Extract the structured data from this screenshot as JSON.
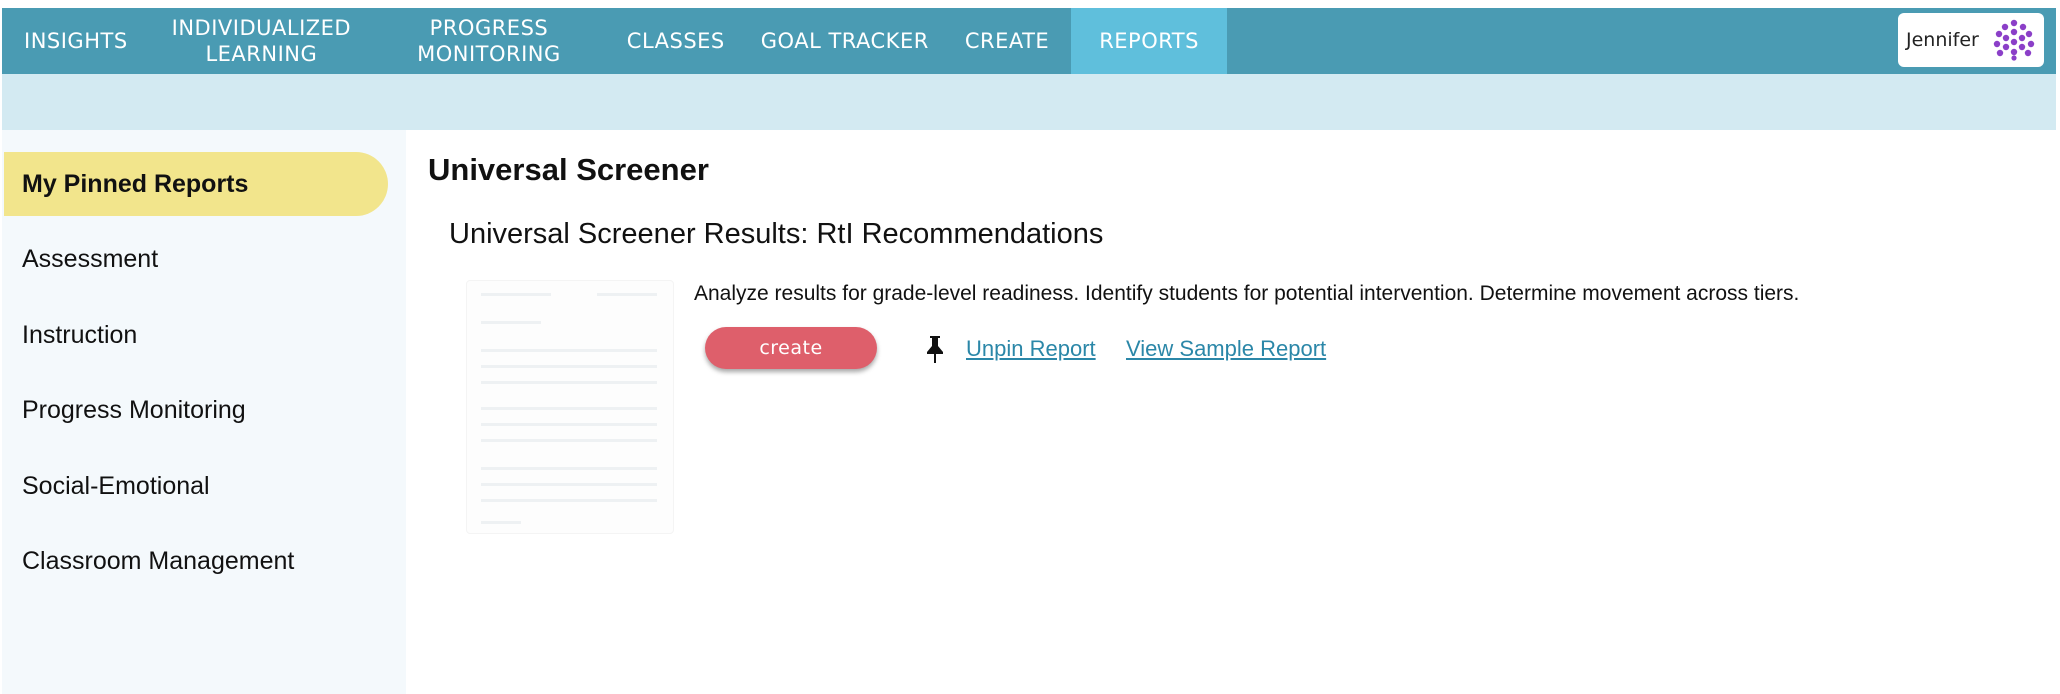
{
  "nav": {
    "items": [
      {
        "label": "INSIGHTS"
      },
      {
        "label": "INDIVIDUALIZED\nLEARNING"
      },
      {
        "label": "PROGRESS\nMONITORING"
      },
      {
        "label": "CLASSES"
      },
      {
        "label": "GOAL TRACKER"
      },
      {
        "label": "CREATE"
      },
      {
        "label": "REPORTS",
        "active": true
      }
    ],
    "user_name": "Jennifer"
  },
  "sidebar": {
    "items": [
      {
        "label": "My Pinned Reports",
        "active": true
      },
      {
        "label": "Assessment"
      },
      {
        "label": "Instruction"
      },
      {
        "label": "Progress Monitoring"
      },
      {
        "label": "Social-Emotional"
      },
      {
        "label": "Classroom Management"
      }
    ]
  },
  "main": {
    "page_title": "Universal Screener",
    "report": {
      "title": "Universal Screener Results: RtI Recommendations",
      "description": "Analyze results for grade-level readiness. Identify students for potential intervention. Determine movement across tiers.",
      "create_label": "create",
      "unpin_label": "Unpin Report",
      "sample_label": "View Sample Report"
    }
  },
  "colors": {
    "nav_bg": "#4a9bb3",
    "nav_active": "#5fbfdc",
    "subbar": "#d3eaf2",
    "sidebar_active": "#f2e58c",
    "create_button": "#de5f6b",
    "link": "#2b87a8",
    "avatar": "#8b3fc8"
  },
  "icons": {
    "pin": "pin-icon",
    "avatar": "avatar-pattern-icon"
  }
}
